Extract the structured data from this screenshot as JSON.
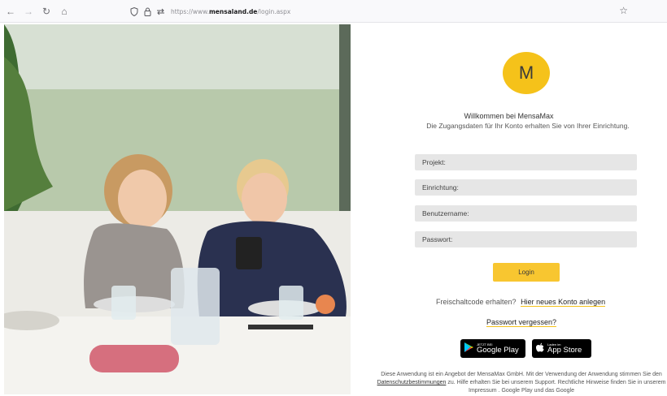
{
  "browser": {
    "url_prefix": "https://www.",
    "url_host": "mensaland.de",
    "url_path": "/login.aspx"
  },
  "icons": [
    "back-icon",
    "forward-icon",
    "reload-icon",
    "home-icon",
    "shield-icon",
    "lock-icon",
    "tracking-icon",
    "star-icon",
    "google-play-icon",
    "apple-icon"
  ],
  "logo": {
    "letter": "M",
    "color": "#f5c21a"
  },
  "welcome": {
    "title": "Willkommen bei MensaMax",
    "subtitle": "Die Zugangsdaten für Ihr Konto erhalten Sie von Ihrer Einrichtung."
  },
  "form": {
    "projekt_placeholder": "Projekt:",
    "einrichtung_placeholder": "Einrichtung:",
    "benutzername_placeholder": "Benutzername:",
    "passwort_placeholder": "Passwort:",
    "login_label": "Login"
  },
  "register": {
    "text": "Freischaltcode erhalten?",
    "link": "Hier neues Konto anlegen"
  },
  "forgot_password": "Passwort vergessen?",
  "stores": {
    "google_small": "JETZT BEI",
    "google_big": "Google Play",
    "apple_small": "Laden im",
    "apple_big": "App Store"
  },
  "footer": {
    "text_1": "Diese Anwendung ist ein Angebot der MensaMax GmbH. Mit der Verwendung der Anwendung stimmen Sie den",
    "link": "Datenschutzbestimmungen",
    "text_2": "zu. Hilfe erhalten Sie bei unserem Support. Rechtliche Hinweise finden Sie in unserem Impressum . Google Play und das Google"
  },
  "accent_color": "#f8c630"
}
